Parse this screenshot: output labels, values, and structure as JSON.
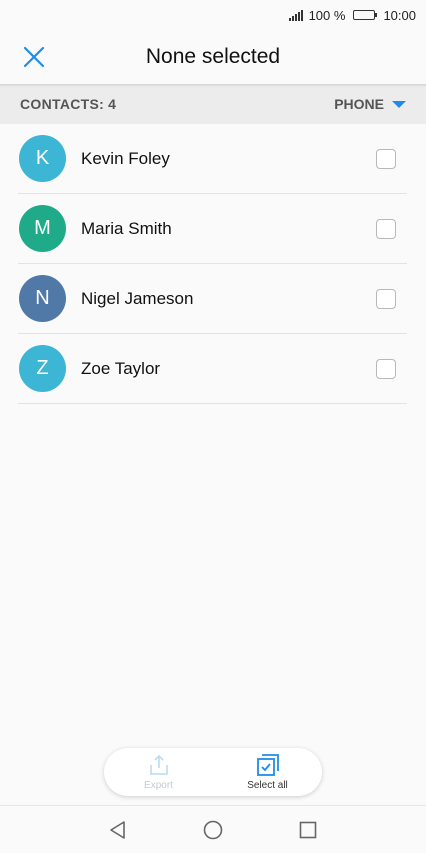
{
  "status": {
    "battery_text": "100 %",
    "time": "10:00"
  },
  "header": {
    "title": "None selected"
  },
  "contacts_bar": {
    "count_label": "CONTACTS:",
    "count_value": "4",
    "filter_label": "PHONE"
  },
  "contacts": [
    {
      "initial": "K",
      "name": "Kevin Foley",
      "color": "#3db5d4",
      "checked": false
    },
    {
      "initial": "M",
      "name": "Maria Smith",
      "color": "#1fab89",
      "checked": false
    },
    {
      "initial": "N",
      "name": "Nigel Jameson",
      "color": "#5079a8",
      "checked": false
    },
    {
      "initial": "Z",
      "name": "Zoe Taylor",
      "color": "#3db5d4",
      "checked": false
    }
  ],
  "actions": {
    "export_label": "Export",
    "select_all_label": "Select all"
  },
  "colors": {
    "accent": "#1f8ceb"
  }
}
